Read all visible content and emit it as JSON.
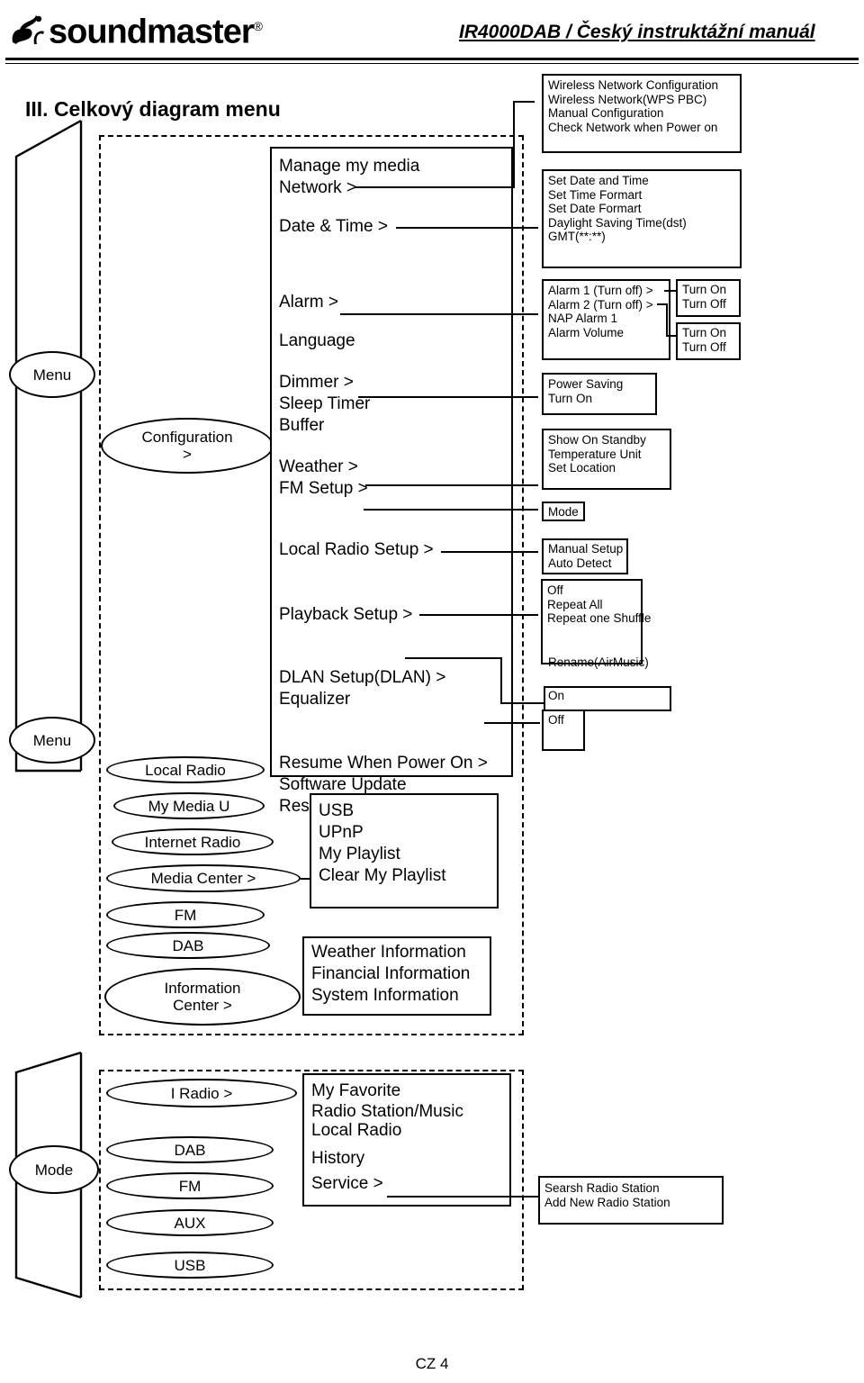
{
  "header": {
    "brand": "soundmaster",
    "brand_reg": "®",
    "title": "IR4000DAB / Český instruktážní manuál",
    "logo_icon": "soundmaster-logo-icon"
  },
  "page_title": "III. Celkový diagram menu",
  "footer": {
    "page_label": "CZ 4"
  },
  "brackets": [
    {
      "name": "menu-bracket",
      "label": "Menu"
    },
    {
      "name": "menu-bracket-2",
      "label": "Menu"
    },
    {
      "name": "mode-bracket",
      "label": "Mode"
    }
  ],
  "menu_group": {
    "root_label": "Configuration\n>",
    "root_label_line1": "Configuration",
    "root_label_line2": ">",
    "config_items": [
      "Manage my media",
      "Network >",
      "Date & Time >",
      "Alarm >",
      "Language",
      "Dimmer >",
      "Sleep Timer",
      "Buffer",
      "Weather >",
      "FM Setup >",
      "Local Radio Setup >",
      "Playback Setup >",
      "DLAN Setup(DLAN) >",
      "Equalizer",
      "Resume When Power On >",
      "Software Update",
      "Reset to Default"
    ],
    "mode_items": [
      "Local Radio",
      "My Media U",
      "Internet Radio",
      "Media Center >",
      "FM",
      "DAB",
      "Information\nCenter >"
    ],
    "mode_items_display": [
      {
        "l1": "Local Radio",
        "l2": ""
      },
      {
        "l1": "My Media U",
        "l2": ""
      },
      {
        "l1": "Internet Radio",
        "l2": ""
      },
      {
        "l1": "Media Center >",
        "l2": ""
      },
      {
        "l1": "FM",
        "l2": ""
      },
      {
        "l1": "DAB",
        "l2": ""
      },
      {
        "l1": "Information",
        "l2": "Center >"
      }
    ],
    "media_center_box": [
      "USB",
      "UPnP",
      "My Playlist",
      "Clear My Playlist"
    ],
    "information_center_box": [
      "Weather  Information",
      "Financial  Information",
      "System Information"
    ]
  },
  "detail_boxes": {
    "network": [
      "Wireless Network Configuration",
      "Wireless Network(WPS PBC)",
      "Manual Configuration",
      "Check Network when Power on"
    ],
    "date_time": [
      "Set Date and Time",
      "Set Time Formart",
      "Set Date Formart",
      "Daylight Saving Time(dst)",
      "GMT(**:**)"
    ],
    "alarm": [
      "Alarm 1 (Turn off) >",
      "Alarm 2 (Turn off) >",
      "NAP Alarm 1",
      "Alarm Volume"
    ],
    "alarm1_sub": [
      "Turn On",
      "Turn Off"
    ],
    "alarm2_sub": [
      "Turn On",
      "Turn Off"
    ],
    "dimmer": [
      "Power Saving",
      "Turn On"
    ],
    "weather": [
      "Show On Standby",
      "Temperature Unit",
      "Set Location"
    ],
    "fm_setup": [
      "Mode"
    ],
    "local_radio_setup": [
      "Manual Setup",
      "Auto Detect"
    ],
    "playback_setup": [
      "Off",
      "Repeat All",
      "Repeat one Shuffle"
    ],
    "dlan_setup": [
      "Rename(AirMusic)",
      "On"
    ],
    "resume_power": [
      "Off"
    ]
  },
  "mode_group": {
    "items": [
      {
        "l1": "I Radio >",
        "l2": ""
      },
      {
        "l1": "DAB",
        "l2": ""
      },
      {
        "l1": "FM",
        "l2": ""
      },
      {
        "l1": "AUX",
        "l2": ""
      },
      {
        "l1": "USB",
        "l2": ""
      }
    ],
    "iradio_box": [
      "My Favorite",
      "Radio Station/Music",
      "Local Radio",
      "History",
      "Service >"
    ],
    "service_box": [
      "Searsh Radio Station",
      "Add New Radio Station"
    ]
  },
  "colors": {
    "line": "#000000",
    "background": "#ffffff"
  }
}
